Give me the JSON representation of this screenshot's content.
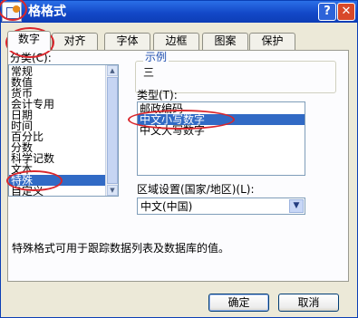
{
  "window": {
    "title": "格格式",
    "help_label": "?",
    "close_label": "✕"
  },
  "tabs": [
    {
      "label": "数字"
    },
    {
      "label": "对齐"
    },
    {
      "label": "字体"
    },
    {
      "label": "边框"
    },
    {
      "label": "图案"
    },
    {
      "label": "保护"
    }
  ],
  "category": {
    "label": "分类(C):",
    "items": [
      "常规",
      "数值",
      "货币",
      "会计专用",
      "日期",
      "时间",
      "百分比",
      "分数",
      "科学记数",
      "文本",
      "特殊",
      "自定义"
    ],
    "selected": "特殊"
  },
  "sample": {
    "label": "示例",
    "value": "三"
  },
  "type": {
    "label": "类型(T):",
    "items": [
      "邮政编码",
      "中文小写数字",
      "中文大写数字"
    ],
    "selected": "中文小写数字"
  },
  "locale": {
    "label": "区域设置(国家/地区)(L):",
    "value": "中文(中国)"
  },
  "description": "特殊格式可用于跟踪数据列表及数据库的值。",
  "buttons": {
    "ok": "确定",
    "cancel": "取消"
  },
  "colors": {
    "selection": "#316ac5",
    "annotation_circle": "#d9262c",
    "titlebar": "#1349c8"
  }
}
